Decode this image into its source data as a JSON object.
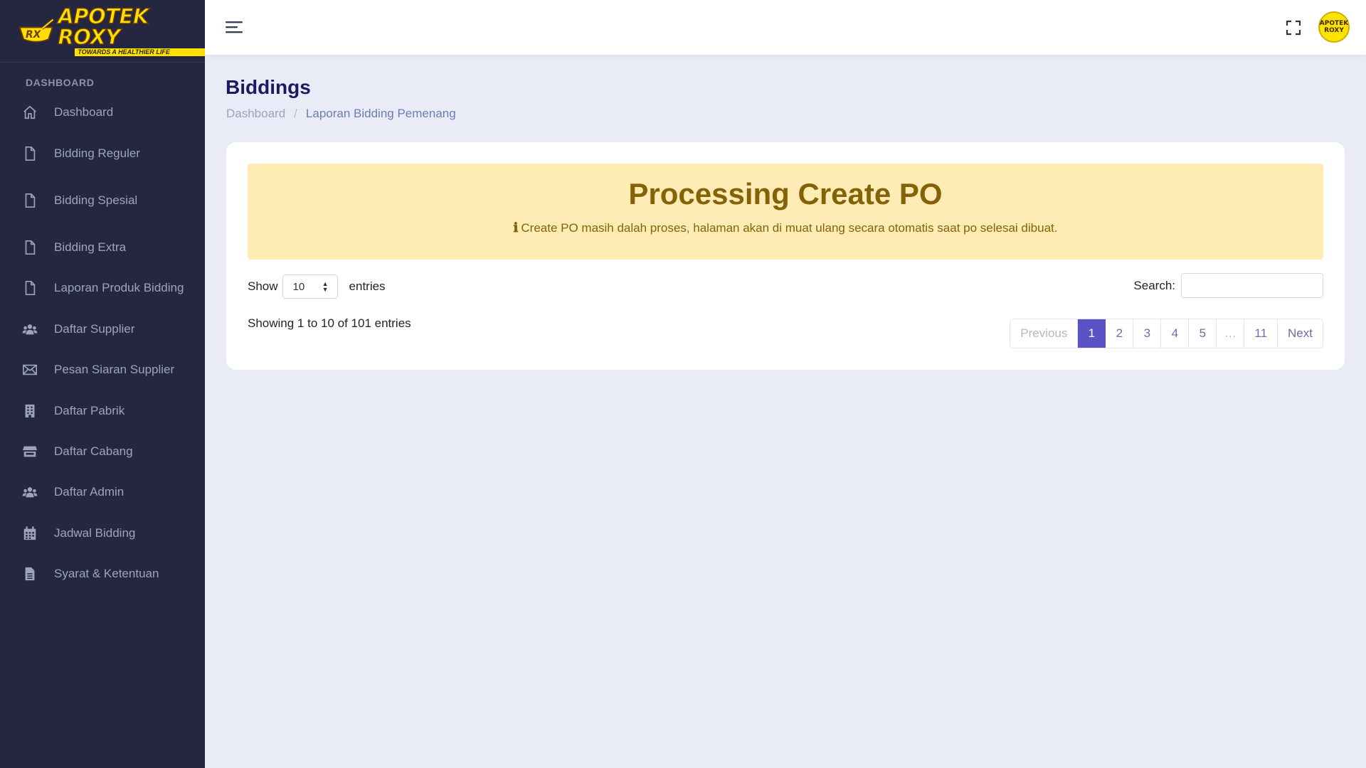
{
  "brand": {
    "logo_text": "APOTEK ROXY",
    "logo_mark": "RX",
    "tagline": "TOWARDS A HEALTHIER LIFE"
  },
  "sidebar": {
    "section_title": "DASHBOARD",
    "items": [
      {
        "label": "Dashboard",
        "icon": "home-icon"
      },
      {
        "label": "Bidding Reguler",
        "icon": "file-icon"
      },
      {
        "label": "Bidding Spesial",
        "icon": "file-icon"
      },
      {
        "label": "Bidding Extra",
        "icon": "file-icon"
      },
      {
        "label": "Laporan Produk Bidding",
        "icon": "file-icon"
      },
      {
        "label": "Daftar Supplier",
        "icon": "users-icon"
      },
      {
        "label": "Pesan Siaran Supplier",
        "icon": "envelope-icon"
      },
      {
        "label": "Daftar Pabrik",
        "icon": "building-icon"
      },
      {
        "label": "Daftar Cabang",
        "icon": "store-icon"
      },
      {
        "label": "Daftar Admin",
        "icon": "users-icon"
      },
      {
        "label": "Jadwal Bidding",
        "icon": "calendar-icon"
      },
      {
        "label": "Syarat & Ketentuan",
        "icon": "document-icon"
      }
    ]
  },
  "topbar": {
    "avatar_line1": "APOTEK",
    "avatar_line2": "ROXY"
  },
  "page": {
    "title": "Biddings",
    "breadcrumb": {
      "home": "Dashboard",
      "separator": "/",
      "current": "Laporan Bidding Pemenang"
    }
  },
  "alert": {
    "title": "Processing Create PO",
    "icon": "info-icon",
    "message": "Create PO masih dalah proses, halaman akan di muat ulang secara otomatis saat po selesai dibuat."
  },
  "table_controls": {
    "show_label": "Show",
    "entries_value": "10",
    "entries_label": "entries",
    "search_label": "Search:",
    "search_value": "",
    "info": "Showing 1 to 10 of 101 entries"
  },
  "pagination": {
    "previous": "Previous",
    "pages": [
      "1",
      "2",
      "3",
      "4",
      "5"
    ],
    "ellipsis": "…",
    "last": "11",
    "next": "Next",
    "active_page": "1"
  },
  "colors": {
    "sidebar_bg": "#252740",
    "page_bg": "#e9ecf6",
    "accent": "#5c52c7",
    "alert_bg": "#ffecb5",
    "alert_text": "#846308",
    "title": "#1c1a5e"
  }
}
